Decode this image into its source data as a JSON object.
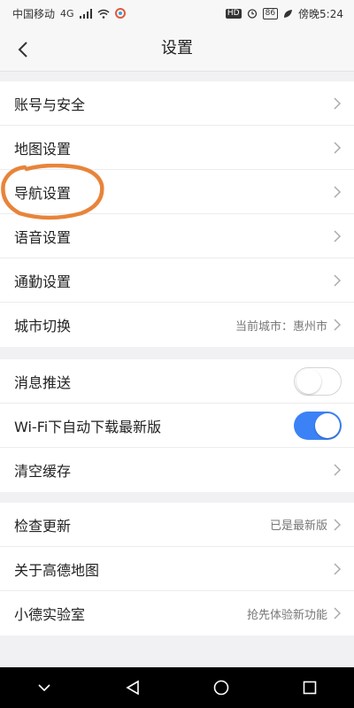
{
  "status_bar": {
    "carrier": "中国移动",
    "network": "4G",
    "battery": "86",
    "time": "傍晚5:24"
  },
  "header": {
    "title": "设置"
  },
  "group1": {
    "items": [
      {
        "label": "账号与安全"
      },
      {
        "label": "地图设置"
      },
      {
        "label": "导航设置"
      },
      {
        "label": "语音设置"
      },
      {
        "label": "通勤设置"
      },
      {
        "label": "城市切换",
        "value": "当前城市：惠州市"
      }
    ]
  },
  "group2": {
    "items": [
      {
        "label": "消息推送",
        "toggle": false
      },
      {
        "label": "Wi-Fi下自动下载最新版",
        "toggle": true
      },
      {
        "label": "清空缓存"
      }
    ]
  },
  "group3": {
    "items": [
      {
        "label": "检查更新",
        "value": "已是最新版"
      },
      {
        "label": "关于高德地图"
      },
      {
        "label": "小德实验室",
        "value": "抢先体验新功能"
      }
    ]
  },
  "colors": {
    "accent": "#3b82f6",
    "annotation": "#e8843a",
    "background": "#f1f1f3"
  }
}
